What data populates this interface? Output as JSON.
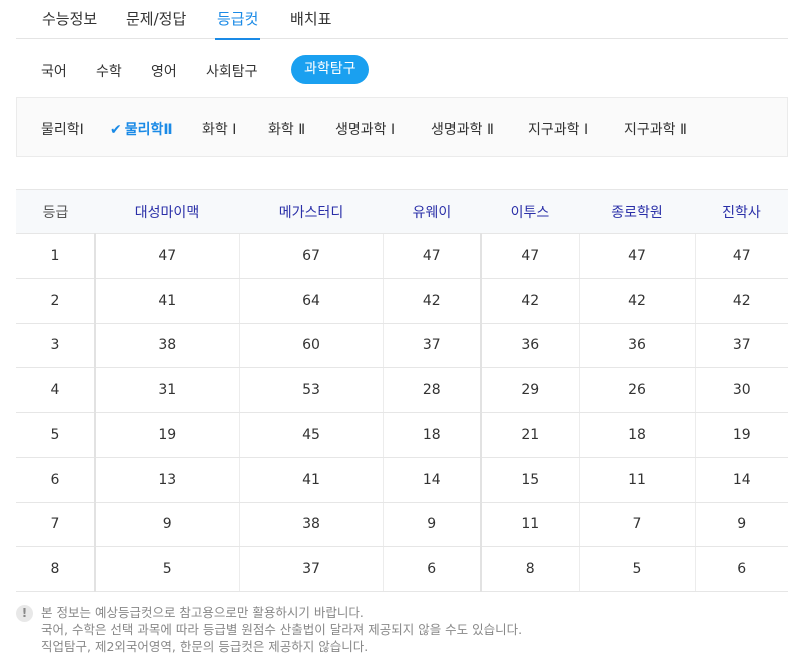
{
  "top_tabs": [
    {
      "label": "수능정보"
    },
    {
      "label": "문제/정답"
    },
    {
      "label": "등급컷",
      "active": true
    },
    {
      "label": "배치표"
    }
  ],
  "subject_tabs": [
    {
      "label": "국어"
    },
    {
      "label": "수학"
    },
    {
      "label": "영어"
    },
    {
      "label": "사회탐구"
    },
    {
      "label": "과학탐구",
      "active": true
    }
  ],
  "science_subjects": [
    {
      "label": "물리학Ⅰ"
    },
    {
      "label": "물리학Ⅱ",
      "active": true
    },
    {
      "label": "화학 Ⅰ"
    },
    {
      "label": "화학 Ⅱ"
    },
    {
      "label": "생명과학 Ⅰ"
    },
    {
      "label": "생명과학 Ⅱ"
    },
    {
      "label": "지구과학 Ⅰ"
    },
    {
      "label": "지구과학 Ⅱ"
    }
  ],
  "check_glyph": "✔",
  "table": {
    "headers": [
      "등급",
      "대성마이맥",
      "메가스터디",
      "유웨이",
      "이투스",
      "종로학원",
      "진학사"
    ],
    "rows": [
      [
        "1",
        "47",
        "67",
        "47",
        "47",
        "47",
        "47"
      ],
      [
        "2",
        "41",
        "64",
        "42",
        "42",
        "42",
        "42"
      ],
      [
        "3",
        "38",
        "60",
        "37",
        "36",
        "36",
        "37"
      ],
      [
        "4",
        "31",
        "53",
        "28",
        "29",
        "26",
        "30"
      ],
      [
        "5",
        "19",
        "45",
        "18",
        "21",
        "18",
        "19"
      ],
      [
        "6",
        "13",
        "41",
        "14",
        "15",
        "11",
        "14"
      ],
      [
        "7",
        "9",
        "38",
        "9",
        "11",
        "7",
        "9"
      ],
      [
        "8",
        "5",
        "37",
        "6",
        "8",
        "5",
        "6"
      ]
    ]
  },
  "notice": {
    "icon": "!",
    "lines": [
      "본 정보는 예상등급컷으로 참고용으로만 활용하시기 바랍니다.",
      "국어, 수학은 선택 과목에 따라 등급별 원점수 산출법이 달라져 제공되지 않을 수도 있습니다.",
      "직업탐구, 제2외국어영역, 한문의 등급컷은 제공하지 않습니다."
    ]
  }
}
